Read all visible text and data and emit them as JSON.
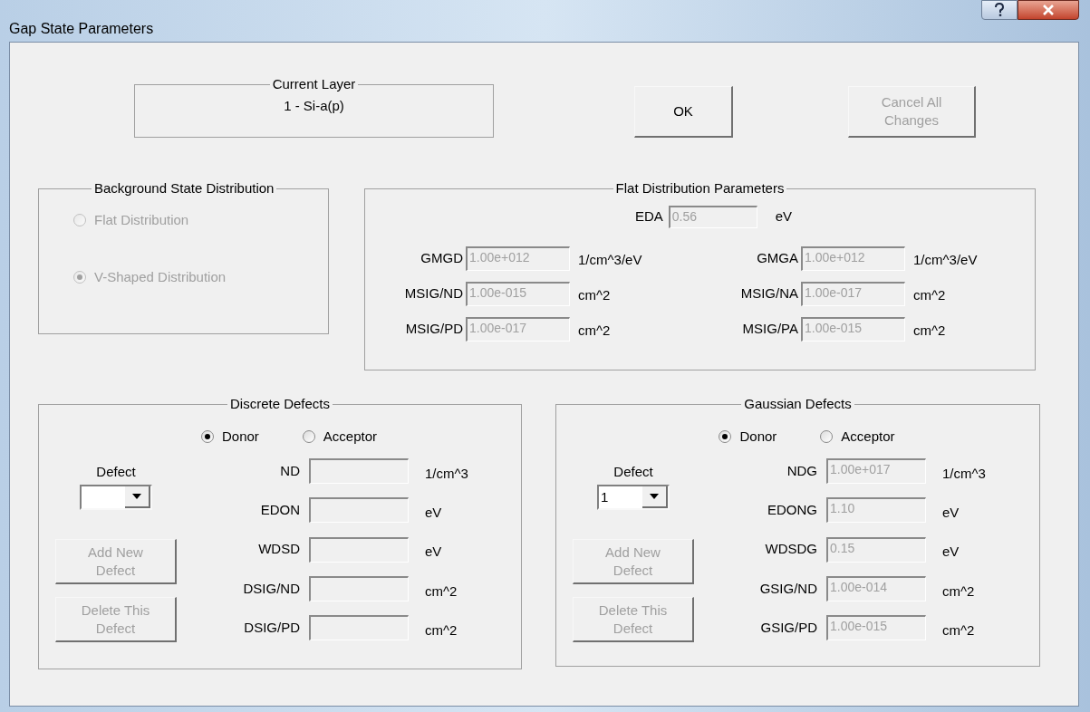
{
  "window": {
    "title": "Gap State Parameters"
  },
  "current_layer": {
    "title": "Current Layer",
    "value": "1 - Si-a(p)"
  },
  "buttons": [
    {
      "label": "OK",
      "disabled": false
    },
    {
      "label": "Cancel All Changes",
      "disabled": true
    }
  ],
  "background": {
    "title": "Background State Distribution",
    "disabled": true,
    "options": [
      {
        "label": "Flat Distribution",
        "selected": false
      },
      {
        "label": "V-Shaped Distribution",
        "selected": true
      }
    ]
  },
  "flat": {
    "title": "Flat Distribution Parameters",
    "eda": {
      "label": "EDA",
      "value": "0.56",
      "unit": "eV",
      "disabled": true
    },
    "fields": [
      {
        "label": "GMGD",
        "value": "1.00e+012",
        "unit": "1/cm^3/eV",
        "disabled": true
      },
      {
        "label": "GMGA",
        "value": "1.00e+012",
        "unit": "1/cm^3/eV",
        "disabled": true
      },
      {
        "label": "MSIG/ND",
        "value": "1.00e-015",
        "unit": "cm^2",
        "disabled": true
      },
      {
        "label": "MSIG/NA",
        "value": "1.00e-017",
        "unit": "cm^2",
        "disabled": true
      },
      {
        "label": "MSIG/PD",
        "value": "1.00e-017",
        "unit": "cm^2",
        "disabled": true
      },
      {
        "label": "MSIG/PA",
        "value": "1.00e-015",
        "unit": "cm^2",
        "disabled": true
      }
    ]
  },
  "defect_groups": [
    {
      "title": "Discrete Defects",
      "types": [
        {
          "label": "Donor",
          "selected": true
        },
        {
          "label": "Acceptor",
          "selected": false
        }
      ],
      "defect": {
        "label": "Defect"
      },
      "buttons": [
        {
          "label": "Add New Defect",
          "disabled": true
        },
        {
          "label": "Delete This Defect",
          "disabled": true
        }
      ],
      "fields": [
        {
          "label": "ND",
          "unit": "1/cm^3",
          "disabled": true
        },
        {
          "label": "EDON",
          "unit": "eV",
          "disabled": true
        },
        {
          "label": "WDSD",
          "unit": "eV",
          "disabled": true
        },
        {
          "label": "DSIG/ND",
          "unit": "cm^2",
          "disabled": true
        },
        {
          "label": "DSIG/PD",
          "unit": "cm^2",
          "disabled": true
        }
      ]
    },
    {
      "title": "Gaussian Defects",
      "types": [
        {
          "label": "Donor",
          "selected": true
        },
        {
          "label": "Acceptor",
          "selected": false
        }
      ],
      "defect": {
        "label": "Defect",
        "value": "1"
      },
      "buttons": [
        {
          "label": "Add New Defect",
          "disabled": true
        },
        {
          "label": "Delete This Defect",
          "disabled": true
        }
      ],
      "fields": [
        {
          "label": "NDG",
          "value": "1.00e+017",
          "unit": "1/cm^3",
          "disabled": true
        },
        {
          "label": "EDONG",
          "value": "1.10",
          "unit": "eV",
          "disabled": true
        },
        {
          "label": "WDSDG",
          "value": "0.15",
          "unit": "eV",
          "disabled": true
        },
        {
          "label": "GSIG/ND",
          "value": "1.00e-014",
          "unit": "cm^2",
          "disabled": true
        },
        {
          "label": "GSIG/PD",
          "value": "1.00e-015",
          "unit": "cm^2",
          "disabled": true
        }
      ]
    }
  ]
}
